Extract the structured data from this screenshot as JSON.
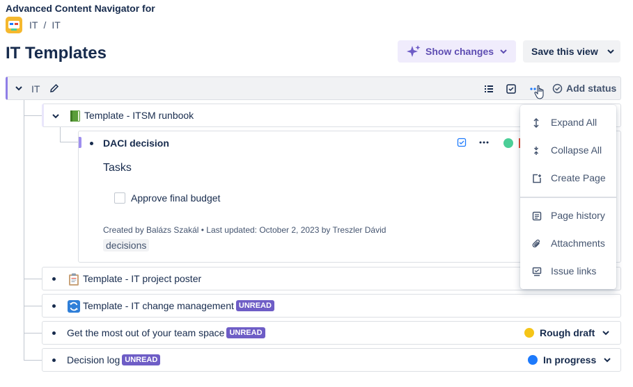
{
  "app": {
    "title": "Advanced Content Navigator for"
  },
  "breadcrumb": {
    "items": [
      "IT",
      "IT"
    ],
    "separator": "/"
  },
  "page": {
    "title": "IT Templates"
  },
  "header": {
    "show_changes_label": "Show changes",
    "save_view_label": "Save this view"
  },
  "root": {
    "label": "IT",
    "add_status_label": "Add status"
  },
  "rows": {
    "runbook": {
      "title": "Template - ITSM runbook",
      "icon": "green-book-icon"
    },
    "daci": {
      "title": "DACI decision",
      "tasks_heading": "Tasks",
      "task_label": "Approve final budget",
      "meta": "Created by Balázs Szakál  •  Last updated: October 2, 2023 by Treszler Dávid",
      "label": "decisions"
    },
    "poster": {
      "title": "Template - IT project poster",
      "icon": "clipboard-icon"
    },
    "change": {
      "title": "Template - IT change management",
      "badge": "UNREAD",
      "icon": "refresh-icon"
    },
    "getmost": {
      "title": "Get the most out of your team space",
      "badge": "UNREAD",
      "status": "Rough draft",
      "status_color": "#f5c518"
    },
    "decision": {
      "title": "Decision log",
      "badge": "UNREAD",
      "status": "In progress",
      "status_color": "#1d7afc"
    }
  },
  "menu": {
    "expand_all": "Expand All",
    "collapse_all": "Collapse All",
    "create_page": "Create Page",
    "page_history": "Page history",
    "attachments": "Attachments",
    "issue_links": "Issue links"
  },
  "colors": {
    "accent_purple": "#6e5dc6",
    "show_changes_bg": "#f0ecfc",
    "badge_bg": "#6e5dc6"
  }
}
